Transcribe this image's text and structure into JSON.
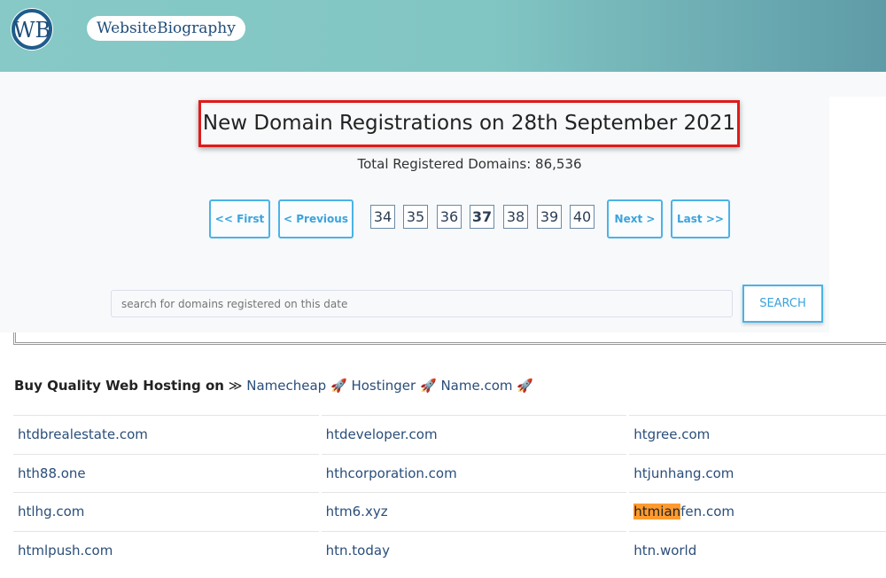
{
  "header": {
    "logo_text": "WB",
    "brand": "WebsiteBiography"
  },
  "main": {
    "title": "New Domain Registrations on 28th September 2021",
    "total": "Total Registered Domains: 86,536",
    "pagination": {
      "first": "<< First",
      "previous": "< Previous",
      "pages": [
        "34",
        "35",
        "36",
        "37",
        "38",
        "39",
        "40"
      ],
      "current": "37",
      "next": "Next >",
      "last": "Last >>"
    },
    "search": {
      "placeholder": "search for domains registered on this date",
      "button": "SEARCH"
    }
  },
  "hosting": {
    "label": "Buy Quality Web Hosting on",
    "separator": "≫",
    "links": [
      "Namecheap",
      "Hostinger",
      "Name.com"
    ],
    "icon": "🚀"
  },
  "domains": [
    [
      "htdbrealestate.com",
      "htdeveloper.com",
      "htgree.com"
    ],
    [
      "hth88.one",
      "hthcorporation.com",
      "htjunhang.com"
    ],
    [
      "htlhg.com",
      "htm6.xyz",
      "htmianfen.com"
    ],
    [
      "htmlpush.com",
      "htn.today",
      "htn.world"
    ]
  ],
  "highlight": {
    "domain": "htmianfen.com",
    "text": "htmian",
    "color": "#ff9a2e"
  }
}
